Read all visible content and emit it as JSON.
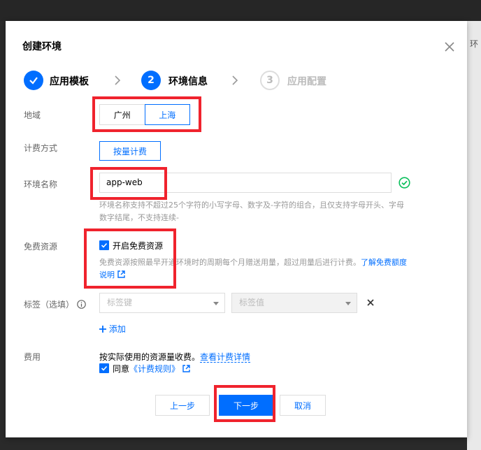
{
  "dialog": {
    "title": "创建环境"
  },
  "steps": [
    {
      "label": "应用模板",
      "state": "done"
    },
    {
      "label": "环境信息",
      "number": "2",
      "state": "current"
    },
    {
      "label": "应用配置",
      "number": "3",
      "state": "todo"
    }
  ],
  "region": {
    "label": "地域",
    "options": [
      "广州",
      "上海"
    ],
    "selected": "上海"
  },
  "billing": {
    "label": "计费方式",
    "option": "按量计费"
  },
  "env_name": {
    "label": "环境名称",
    "value": "app-web",
    "hint_line1": "环境名称支持不超过25个字符的小写字母、数字及-字符的组合，且仅支持字母开头、字母",
    "hint_line2": "数字结尾，不支持连续-"
  },
  "free_resource": {
    "label": "免费资源",
    "checkbox_label": "开启免费资源",
    "checked": true,
    "desc": "免费资源按照最早开通环境时的周期每个月赠送用量，超过用量后进行计费。",
    "link_part1": "了解免费额度",
    "link_part2": "说明"
  },
  "tags": {
    "label": "标签（选填）",
    "key_placeholder": "标签键",
    "value_placeholder": "标签值",
    "add_label": "添加"
  },
  "fee": {
    "label": "费用",
    "text": "按实际使用的资源量收费。",
    "link": "查看计费详情",
    "agree_text": "同意",
    "agree_link": "《计费规则》",
    "agree_checked": true
  },
  "buttons": {
    "prev": "上一步",
    "next": "下一步",
    "cancel": "取消"
  },
  "background": {
    "right_text": "环"
  },
  "colors": {
    "primary": "#006eff",
    "annotation": "#f0232d",
    "success": "#0abf5b"
  }
}
